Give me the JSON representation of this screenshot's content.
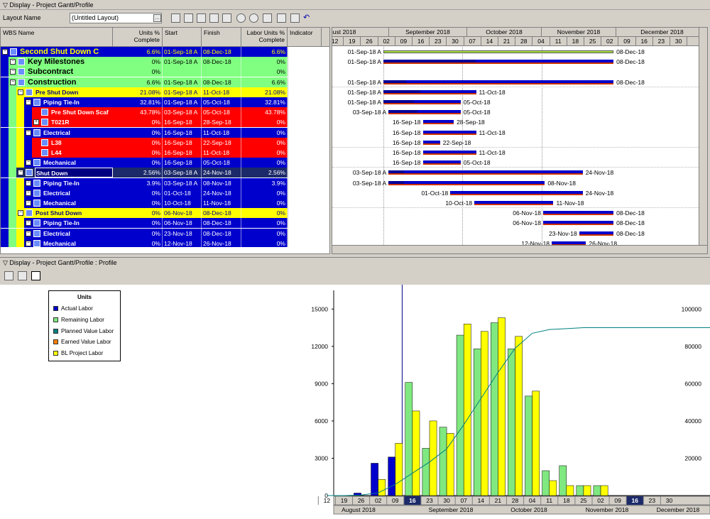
{
  "top_panel": {
    "title": "Display - Project Gantt/Profile"
  },
  "toolbar": {
    "layout_label": "Layout Name",
    "layout_value": "(Untitled Layout)"
  },
  "columns": {
    "wbs": "WBS Name",
    "units_pct": "Units % Complete",
    "start": "Start",
    "finish": "Finish",
    "labor_pct": "Labor Units % Complete",
    "indicator": "Indicator"
  },
  "rows": [
    {
      "name": "Second Shut Down C",
      "units": "6.6%",
      "start": "01-Sep-18 A",
      "finish": "08-Dec-18",
      "labor": "6.6%",
      "level": 0,
      "bg": "#0000cc",
      "fg": "#ffff00",
      "bold": true,
      "big": true
    },
    {
      "name": "Key Milestones",
      "units": "0%",
      "start": "01-Sep-18 A",
      "finish": "08-Dec-18",
      "labor": "0%",
      "level": 1,
      "bg": "#80ff80",
      "fg": "#000",
      "bold": true,
      "big": true
    },
    {
      "name": "Subcontract",
      "units": "0%",
      "start": "",
      "finish": "",
      "labor": "0%",
      "level": 1,
      "bg": "#80ff80",
      "fg": "#000",
      "bold": true,
      "big": true
    },
    {
      "name": "Construction",
      "units": "6.6%",
      "start": "01-Sep-18 A",
      "finish": "08-Dec-18",
      "labor": "6.6%",
      "level": 1,
      "bg": "#80ff80",
      "fg": "#000",
      "bold": true,
      "big": true
    },
    {
      "name": "Pre Shut Down",
      "units": "21.08%",
      "start": "01-Sep-18 A",
      "finish": "11-Oct-18",
      "labor": "21.08%",
      "level": 2,
      "bg": "#ffff00",
      "fg": "#000080",
      "bold": true
    },
    {
      "name": "Piping Tie-In",
      "units": "32.81%",
      "start": "01-Sep-18 A",
      "finish": "05-Oct-18",
      "labor": "32.81%",
      "level": 3,
      "bg": "#0000cc",
      "fg": "#ffffff",
      "bold": true
    },
    {
      "name": "Pre Shut Down Scaf",
      "units": "43.78%",
      "start": "03-Sep-18 A",
      "finish": "05-Oct-18",
      "labor": "43.78%",
      "level": 4,
      "bg": "#ff0000",
      "fg": "#ffffff",
      "bold": true
    },
    {
      "name": "T021R",
      "units": "0%",
      "start": "16-Sep-18",
      "finish": "28-Sep-18",
      "labor": "0%",
      "level": 4,
      "bg": "#ff0000",
      "fg": "#ffffff",
      "bold": true
    },
    {
      "name": "Electrical",
      "units": "0%",
      "start": "16-Sep-18",
      "finish": "11-Oct-18",
      "labor": "0%",
      "level": 3,
      "bg": "#0000cc",
      "fg": "#ffffff",
      "bold": true
    },
    {
      "name": "L38",
      "units": "0%",
      "start": "16-Sep-18",
      "finish": "22-Sep-18",
      "labor": "0%",
      "level": 4,
      "bg": "#ff0000",
      "fg": "#ffffff",
      "bold": true
    },
    {
      "name": "L44",
      "units": "0%",
      "start": "16-Sep-18",
      "finish": "11-Oct-18",
      "labor": "0%",
      "level": 4,
      "bg": "#ff0000",
      "fg": "#ffffff",
      "bold": true
    },
    {
      "name": "Mechanical",
      "units": "0%",
      "start": "16-Sep-18",
      "finish": "05-Oct-18",
      "labor": "0%",
      "level": 3,
      "bg": "#0000cc",
      "fg": "#ffffff",
      "bold": true
    },
    {
      "name": "Shut Down",
      "units": "2.56%",
      "start": "03-Sep-18 A",
      "finish": "24-Nov-18",
      "labor": "2.56%",
      "level": 2,
      "bg": "#1c2a6a",
      "fg": "#ffffff",
      "bold": true,
      "selected": true
    },
    {
      "name": "Piping Tie-In",
      "units": "3.9%",
      "start": "03-Sep-18 A",
      "finish": "08-Nov-18",
      "labor": "3.9%",
      "level": 3,
      "bg": "#0000cc",
      "fg": "#ffffff",
      "bold": true
    },
    {
      "name": "Electrical",
      "units": "0%",
      "start": "01-Oct-18",
      "finish": "24-Nov-18",
      "labor": "0%",
      "level": 3,
      "bg": "#0000cc",
      "fg": "#ffffff",
      "bold": true
    },
    {
      "name": "Mechanical",
      "units": "0%",
      "start": "10-Oct-18",
      "finish": "11-Nov-18",
      "labor": "0%",
      "level": 3,
      "bg": "#0000cc",
      "fg": "#ffffff",
      "bold": true
    },
    {
      "name": "Post Shut Down",
      "units": "0%",
      "start": "06-Nov-18",
      "finish": "08-Dec-18",
      "labor": "0%",
      "level": 2,
      "bg": "#ffff00",
      "fg": "#000080",
      "bold": true
    },
    {
      "name": "Piping Tie-In",
      "units": "0%",
      "start": "06-Nov-18",
      "finish": "08-Dec-18",
      "labor": "0%",
      "level": 3,
      "bg": "#0000cc",
      "fg": "#ffffff",
      "bold": true
    },
    {
      "name": "Electrical",
      "units": "0%",
      "start": "23-Nov-18",
      "finish": "08-Dec-18",
      "labor": "0%",
      "level": 3,
      "bg": "#0000cc",
      "fg": "#ffffff",
      "bold": true
    },
    {
      "name": "Mechanical",
      "units": "0%",
      "start": "12-Nov-18",
      "finish": "26-Nov-18",
      "labor": "0%",
      "level": 3,
      "bg": "#0000cc",
      "fg": "#ffffff",
      "bold": true
    }
  ],
  "timeline": {
    "months": [
      "August 2018",
      "September 2018",
      "October 2018",
      "November 2018",
      "December 2018"
    ],
    "weeks": [
      "12",
      "19",
      "26",
      "02",
      "09",
      "16",
      "23",
      "30",
      "07",
      "14",
      "21",
      "28",
      "04",
      "11",
      "18",
      "25",
      "02",
      "09",
      "16",
      "23",
      "30"
    ]
  },
  "gantt_bars": [
    {
      "type": "milestone",
      "s": 3.3,
      "e": 16.7,
      "ls": "01-Sep-18 A",
      "le": "08-Dec-18"
    },
    {
      "s": 3.3,
      "e": 16.7,
      "p": 0.4,
      "ls": "01-Sep-18 A",
      "le": "08-Dec-18"
    },
    {
      "s": -1,
      "e": -1,
      "ls": "",
      "le": ""
    },
    {
      "s": 3.3,
      "e": 16.7,
      "p": 0.1,
      "ls": "01-Sep-18 A",
      "le": "08-Dec-18"
    },
    {
      "s": 3.3,
      "e": 8.7,
      "p": 0.4,
      "ls": "01-Sep-18 A",
      "le": "11-Oct-18"
    },
    {
      "s": 3.3,
      "e": 7.8,
      "p": 0.4,
      "ls": "01-Sep-18 A",
      "le": "05-Oct-18"
    },
    {
      "s": 3.6,
      "e": 7.8,
      "p": 0.4,
      "ls": "03-Sep-18 A",
      "le": "05-Oct-18"
    },
    {
      "s": 5.6,
      "e": 7.4,
      "p": 0,
      "ls": "16-Sep-18",
      "le": "28-Sep-18"
    },
    {
      "s": 5.6,
      "e": 8.7,
      "p": 0,
      "ls": "16-Sep-18",
      "le": "11-Oct-18"
    },
    {
      "s": 5.6,
      "e": 6.6,
      "p": 0,
      "ls": "16-Sep-18",
      "le": "22-Sep-18"
    },
    {
      "s": 5.6,
      "e": 8.7,
      "p": 0,
      "ls": "16-Sep-18",
      "le": "11-Oct-18"
    },
    {
      "s": 5.6,
      "e": 7.8,
      "p": 0,
      "ls": "16-Sep-18",
      "le": "05-Oct-18"
    },
    {
      "s": 3.6,
      "e": 14.9,
      "p": 0.08,
      "ls": "03-Sep-18 A",
      "le": "24-Nov-18"
    },
    {
      "s": 3.6,
      "e": 12.7,
      "p": 0.1,
      "ls": "03-Sep-18 A",
      "le": "08-Nov-18"
    },
    {
      "s": 7.2,
      "e": 14.9,
      "p": 0,
      "ls": "01-Oct-18",
      "le": "24-Nov-18"
    },
    {
      "s": 8.6,
      "e": 13.2,
      "p": 0,
      "ls": "10-Oct-18",
      "le": "11-Nov-18"
    },
    {
      "s": 12.6,
      "e": 16.7,
      "p": 0,
      "ls": "06-Nov-18",
      "le": "08-Dec-18"
    },
    {
      "s": 12.6,
      "e": 16.7,
      "p": 0,
      "ls": "06-Nov-18",
      "le": "08-Dec-18"
    },
    {
      "s": 14.7,
      "e": 16.7,
      "p": 0,
      "ls": "23-Nov-18",
      "le": "08-Dec-18"
    },
    {
      "s": 13.1,
      "e": 15.1,
      "p": 0,
      "ls": "12-Nov-18",
      "le": "26-Nov-18"
    }
  ],
  "profile_panel": {
    "title": "Display - Project Gantt/Profile : Profile"
  },
  "legend": {
    "title": "Units",
    "items": [
      {
        "label": "Actual Labor",
        "color": "#0000cc"
      },
      {
        "label": "Remaining Labor",
        "color": "#80e880"
      },
      {
        "label": "Planned Value Labor",
        "color": "#008080"
      },
      {
        "label": "Earned Value Labor",
        "color": "#ff8000"
      },
      {
        "label": "BL Project Labor",
        "color": "#ffff00"
      }
    ]
  },
  "chart_data": {
    "type": "bar",
    "categories": [
      "12",
      "19",
      "26",
      "02",
      "09",
      "16",
      "23",
      "30",
      "07",
      "14",
      "21",
      "28",
      "04",
      "11",
      "18",
      "25",
      "02",
      "09",
      "16",
      "23",
      "30"
    ],
    "month_labels": [
      "August 2018",
      "September 2018",
      "October 2018",
      "November 2018",
      "December 2018"
    ],
    "series": [
      {
        "name": "Actual Labor",
        "color": "#0000cc",
        "values": [
          0,
          0,
          200,
          2600,
          3100,
          0,
          0,
          0,
          0,
          0,
          0,
          0,
          0,
          0,
          0,
          0,
          0,
          0,
          0,
          0,
          0
        ]
      },
      {
        "name": "Remaining Labor",
        "color": "#80e880",
        "values": [
          0,
          0,
          0,
          0,
          0,
          9100,
          3800,
          5500,
          12900,
          11800,
          13900,
          11800,
          8000,
          2000,
          2400,
          800,
          800,
          0,
          0,
          0,
          0
        ]
      },
      {
        "name": "BL Project Labor",
        "color": "#ffff00",
        "values": [
          0,
          0,
          0,
          1300,
          4200,
          6800,
          6000,
          5000,
          13800,
          13200,
          14300,
          12800,
          8400,
          1200,
          800,
          800,
          800,
          0,
          0,
          0,
          0
        ]
      }
    ],
    "cumulative": {
      "name": "Planned Value Labor",
      "color": "#008080",
      "values": [
        0,
        0,
        300,
        1500,
        6000,
        12000,
        18000,
        25000,
        38000,
        52000,
        66000,
        79000,
        87000,
        89000,
        89500,
        90000,
        90000,
        90000,
        90000,
        90000,
        90000
      ]
    },
    "ylim": [
      0,
      16500
    ],
    "yticks": [
      0,
      3000,
      6000,
      9000,
      12000,
      15000
    ],
    "y2lim": [
      0,
      110000
    ],
    "y2ticks": [
      20000,
      40000,
      60000,
      80000,
      100000
    ],
    "current_week": "16"
  }
}
